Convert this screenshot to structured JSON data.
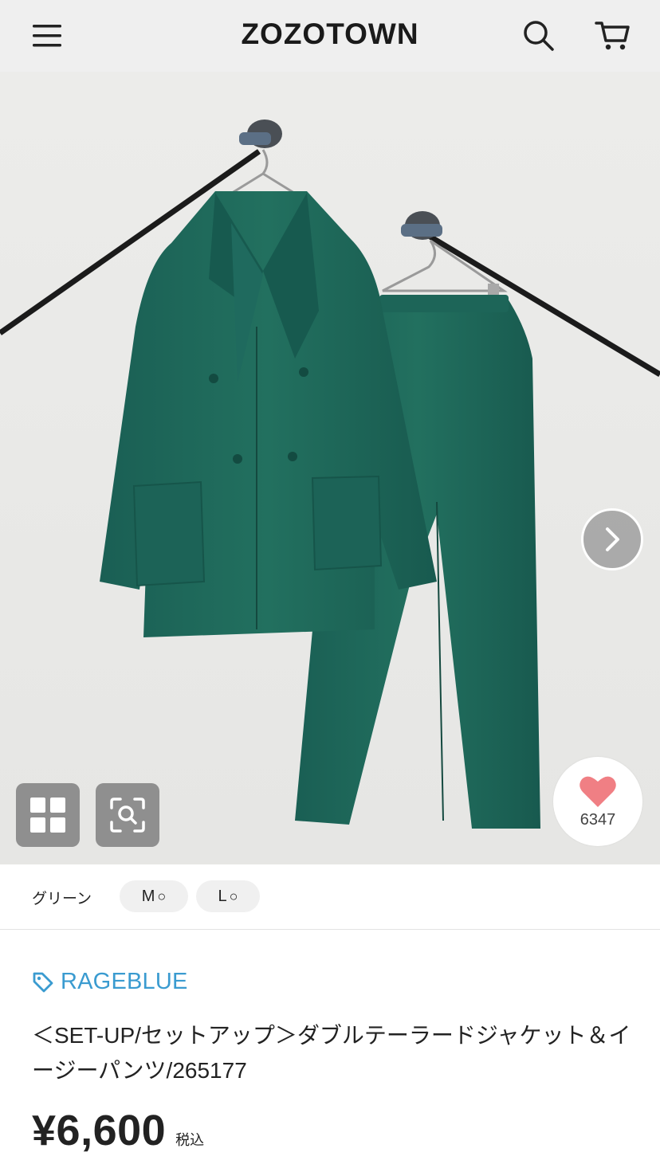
{
  "header": {
    "logo": "ZOZOTOWN",
    "icons": {
      "menu": "hamburger-menu-icon",
      "search": "search-icon",
      "cart": "cart-icon"
    }
  },
  "product_image": {
    "icons": {
      "next": "chevron-right-icon",
      "grid": "grid-icon",
      "zoom": "zoom-scan-icon",
      "favorite": "heart-icon"
    },
    "favorite_count": "6347"
  },
  "variant": {
    "color": "グリーン",
    "sizes": [
      {
        "size": "M",
        "stock": "○"
      },
      {
        "size": "L",
        "stock": "○"
      }
    ]
  },
  "product": {
    "brand": "RAGEBLUE",
    "brand_icon": "tag-icon",
    "title": "＜SET-UP/セットアップ＞ダブルテーラードジャケット＆イージーパンツ/265177",
    "price": "¥6,600",
    "tax_label": "税込"
  },
  "colors": {
    "header_bg": "#efefef",
    "brand": "#3a9bd0",
    "garment": "#1f6a5e",
    "heart": "#f07f84"
  }
}
